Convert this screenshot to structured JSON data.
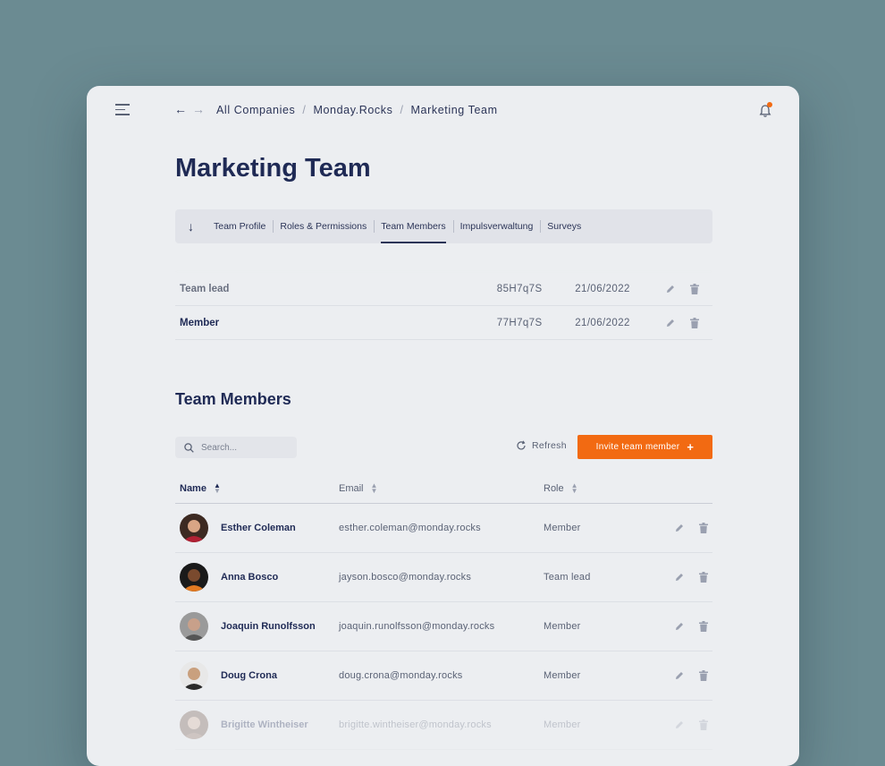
{
  "header": {
    "breadcrumb": [
      "All Companies",
      "Monday.Rocks",
      "Marketing Team"
    ],
    "back_icon": "arrow-left-icon",
    "forward_icon": "arrow-right-icon",
    "notification_icon": "bell-icon",
    "notification_dot_color": "#f26a12"
  },
  "page_title": "Marketing Team",
  "tabs": [
    {
      "label": "Team Profile",
      "active": false
    },
    {
      "label": "Roles & Permissions",
      "active": false
    },
    {
      "label": "Team Members",
      "active": true
    },
    {
      "label": "Impulsverwaltung",
      "active": false
    },
    {
      "label": "Surveys",
      "active": false
    }
  ],
  "roles": [
    {
      "name": "Team lead",
      "code": "85H7q7S",
      "date": "21/06/2022"
    },
    {
      "name": "Member",
      "code": "77H7q7S",
      "date": "21/06/2022"
    }
  ],
  "members_section": {
    "title": "Team Members",
    "search_placeholder": "Search...",
    "refresh_label": "Refresh",
    "invite_label": "Invite team member",
    "invite_color": "#f26a12",
    "columns": [
      "Name",
      "Email",
      "Role"
    ],
    "rows": [
      {
        "name": "Esther Coleman",
        "email": "esther.coleman@monday.rocks",
        "role": "Member"
      },
      {
        "name": "Anna Bosco",
        "email": "jayson.bosco@monday.rocks",
        "role": "Team lead"
      },
      {
        "name": "Joaquin Runolfsson",
        "email": "joaquin.runolfsson@monday.rocks",
        "role": "Member"
      },
      {
        "name": "Doug Crona",
        "email": "doug.crona@monday.rocks",
        "role": "Member"
      },
      {
        "name": "Brigitte Wintheiser",
        "email": "brigitte.wintheiser@monday.rocks",
        "role": "Member"
      }
    ]
  }
}
